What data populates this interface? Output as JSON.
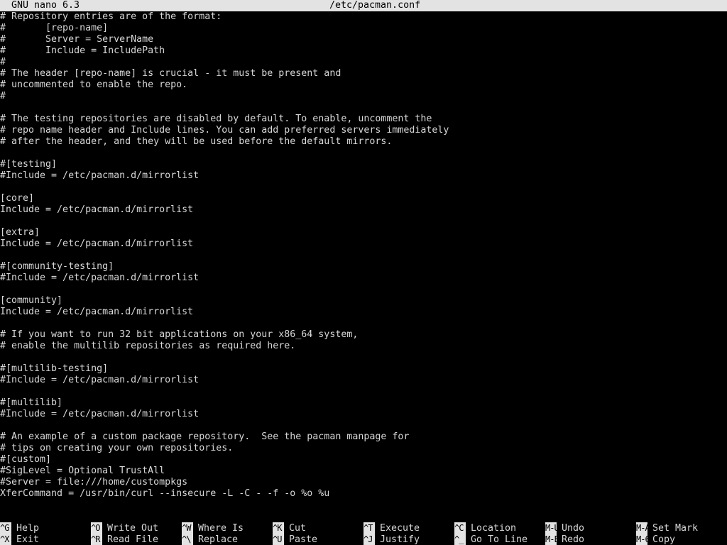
{
  "titlebar": {
    "version": "GNU nano 6.3",
    "filename": "/etc/pacman.conf"
  },
  "lines": [
    "# Repository entries are of the format:",
    "#       [repo-name]",
    "#       Server = ServerName",
    "#       Include = IncludePath",
    "#",
    "# The header [repo-name] is crucial - it must be present and",
    "# uncommented to enable the repo.",
    "#",
    "",
    "# The testing repositories are disabled by default. To enable, uncomment the",
    "# repo name header and Include lines. You can add preferred servers immediately",
    "# after the header, and they will be used before the default mirrors.",
    "",
    "#[testing]",
    "#Include = /etc/pacman.d/mirrorlist",
    "",
    "[core]",
    "Include = /etc/pacman.d/mirrorlist",
    "",
    "[extra]",
    "Include = /etc/pacman.d/mirrorlist",
    "",
    "#[community-testing]",
    "#Include = /etc/pacman.d/mirrorlist",
    "",
    "[community]",
    "Include = /etc/pacman.d/mirrorlist",
    "",
    "# If you want to run 32 bit applications on your x86_64 system,",
    "# enable the multilib repositories as required here.",
    "",
    "#[multilib-testing]",
    "#Include = /etc/pacman.d/mirrorlist",
    "",
    "#[multilib]",
    "#Include = /etc/pacman.d/mirrorlist",
    "",
    "# An example of a custom package repository.  See the pacman manpage for",
    "# tips on creating your own repositories.",
    "#[custom]",
    "#SigLevel = Optional TrustAll",
    "#Server = file:///home/custompkgs",
    "XferCommand = /usr/bin/curl --insecure -L -C - -f -o %o %u"
  ],
  "shortcuts_top": [
    {
      "key": "^G",
      "label": "Help"
    },
    {
      "key": "^O",
      "label": "Write Out"
    },
    {
      "key": "^W",
      "label": "Where Is"
    },
    {
      "key": "^K",
      "label": "Cut"
    },
    {
      "key": "^T",
      "label": "Execute"
    },
    {
      "key": "^C",
      "label": "Location"
    },
    {
      "key": "M-U",
      "label": "Undo"
    },
    {
      "key": "M-A",
      "label": "Set Mark"
    }
  ],
  "shortcuts_bottom": [
    {
      "key": "^X",
      "label": "Exit"
    },
    {
      "key": "^R",
      "label": "Read File"
    },
    {
      "key": "^\\",
      "label": "Replace"
    },
    {
      "key": "^U",
      "label": "Paste"
    },
    {
      "key": "^J",
      "label": "Justify"
    },
    {
      "key": "^_",
      "label": "Go To Line"
    },
    {
      "key": "M-E",
      "label": "Redo"
    },
    {
      "key": "M-6",
      "label": "Copy"
    }
  ],
  "colors": {
    "background": "#000000",
    "foreground": "#d7d7d7",
    "highlight": "#e3e3e3"
  }
}
